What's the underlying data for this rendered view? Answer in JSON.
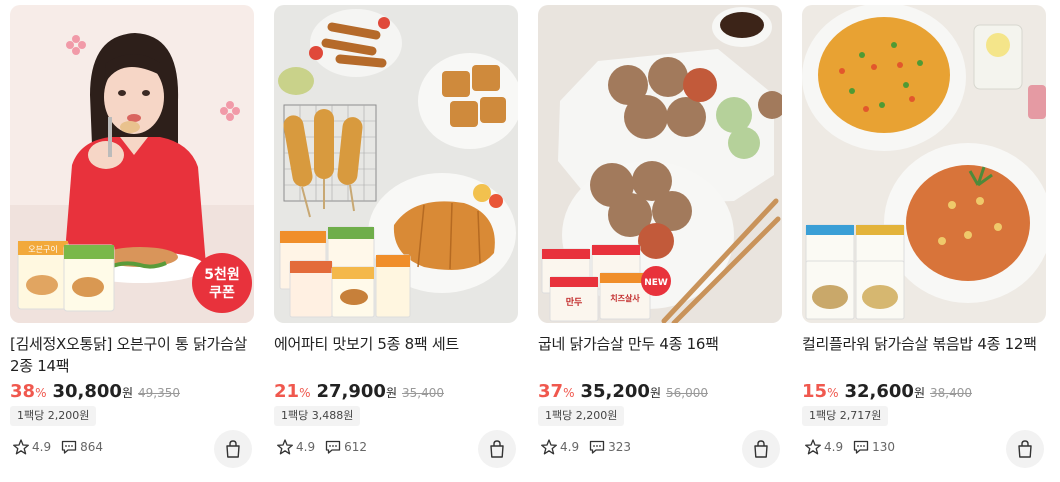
{
  "products": [
    {
      "title": "[김세정X오통닭] 오븐구이 통 닭가슴살 2종 14팩",
      "discount": "38",
      "discount_unit": "%",
      "price": "30,800",
      "currency": "원",
      "original_price": "49,350",
      "unit_price": "1팩당 2,200원",
      "rating": "4.9",
      "reviews": "864",
      "image": {
        "badge_line1": "5천원",
        "badge_line2": "쿠폰",
        "pack_label": "오븐구이"
      }
    },
    {
      "title": "에어파티 맛보기 5종 8팩 세트",
      "discount": "21",
      "discount_unit": "%",
      "price": "27,900",
      "currency": "원",
      "original_price": "35,400",
      "unit_price": "1팩당 3,488원",
      "rating": "4.9",
      "reviews": "612",
      "image": {}
    },
    {
      "title": "굽네 닭가슴살 만두 4종 16팩",
      "discount": "37",
      "discount_unit": "%",
      "price": "35,200",
      "currency": "원",
      "original_price": "56,000",
      "unit_price": "1팩당 2,200원",
      "rating": "4.9",
      "reviews": "323",
      "image": {
        "new_badge": "NEW",
        "pack_label_a": "만두",
        "pack_label_b": "치즈살사"
      }
    },
    {
      "title": "컬리플라워 닭가슴살 볶음밥 4종 12팩",
      "discount": "15",
      "discount_unit": "%",
      "price": "32,600",
      "currency": "원",
      "original_price": "38,400",
      "unit_price": "1팩당 2,717원",
      "rating": "4.9",
      "reviews": "130",
      "image": {}
    }
  ],
  "icons": {
    "rating": "star-icon",
    "reviews": "speech-bubble-icon",
    "cart": "shopping-bag-icon"
  },
  "colors": {
    "discount": "#f0584e",
    "coupon_badge": "#e8323c",
    "new_badge": "#e8323c"
  }
}
